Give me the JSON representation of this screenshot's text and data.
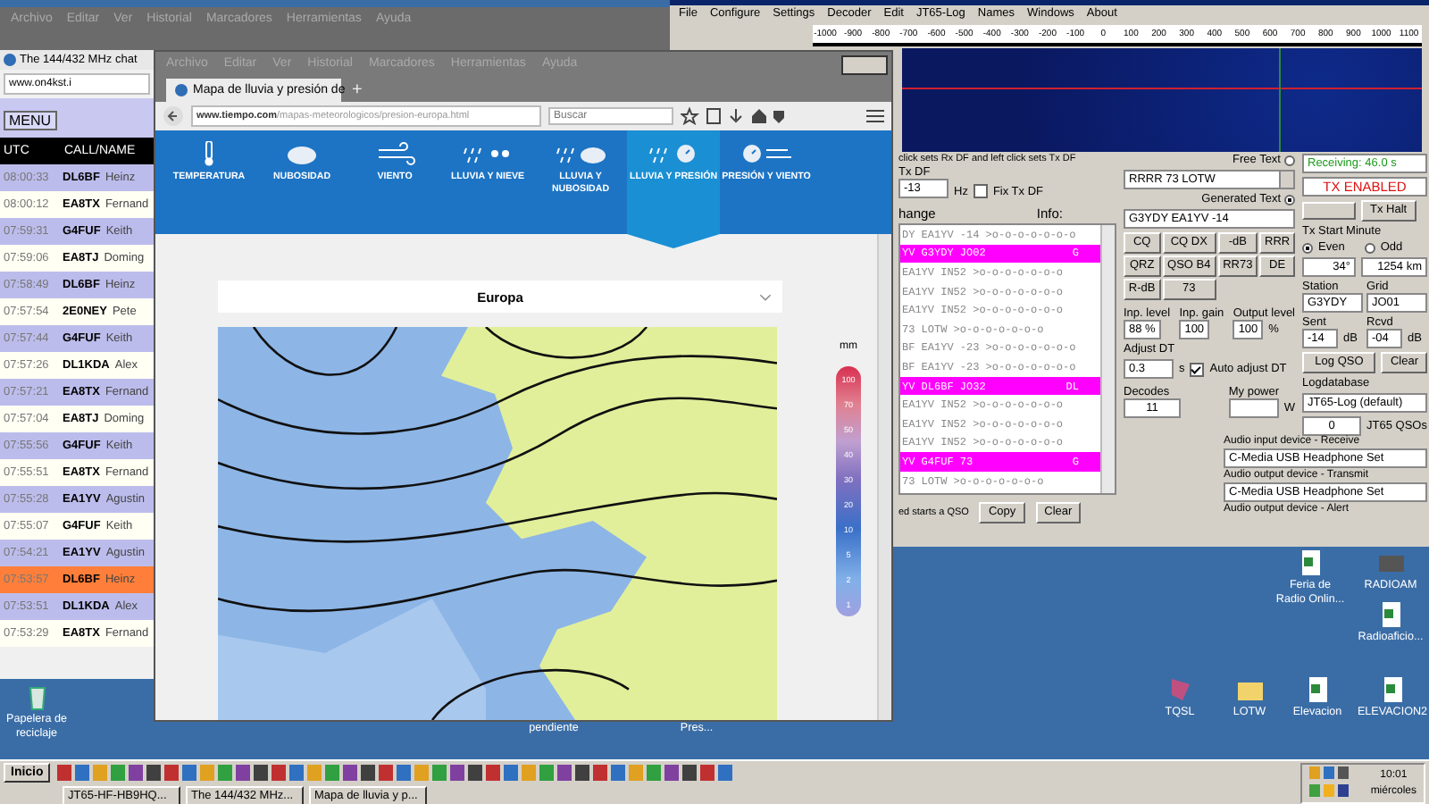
{
  "chat_window": {
    "menu": [
      "Archivo",
      "Editar",
      "Ver",
      "Historial",
      "Marcadores",
      "Herramientas",
      "Ayuda"
    ],
    "tab": "The 144/432 MHz chat",
    "url": "www.on4kst.i",
    "menu_button": "MENU",
    "columns": [
      "UTC",
      "CALL/NAME"
    ],
    "rows": [
      {
        "time": "08:00:33",
        "call": "DL6BF",
        "name": "Heinz",
        "kind": "shaded"
      },
      {
        "time": "08:00:12",
        "call": "EA8TX",
        "name": "Fernand",
        "kind": "plain"
      },
      {
        "time": "07:59:31",
        "call": "G4FUF",
        "name": "Keith",
        "kind": "shaded"
      },
      {
        "time": "07:59:06",
        "call": "EA8TJ",
        "name": "Doming",
        "kind": "plain"
      },
      {
        "time": "07:58:49",
        "call": "DL6BF",
        "name": "Heinz",
        "kind": "shaded"
      },
      {
        "time": "07:57:54",
        "call": "2E0NEY",
        "name": "Pete",
        "kind": "plain"
      },
      {
        "time": "07:57:44",
        "call": "G4FUF",
        "name": "Keith",
        "kind": "shaded"
      },
      {
        "time": "07:57:26",
        "call": "DL1KDA",
        "name": "Alex",
        "kind": "plain"
      },
      {
        "time": "07:57:21",
        "call": "EA8TX",
        "name": "Fernand",
        "kind": "shaded"
      },
      {
        "time": "07:57:04",
        "call": "EA8TJ",
        "name": "Doming",
        "kind": "plain"
      },
      {
        "time": "07:55:56",
        "call": "G4FUF",
        "name": "Keith",
        "kind": "shaded"
      },
      {
        "time": "07:55:51",
        "call": "EA8TX",
        "name": "Fernand",
        "kind": "plain"
      },
      {
        "time": "07:55:28",
        "call": "EA1YV",
        "name": "Agustin",
        "kind": "shaded"
      },
      {
        "time": "07:55:07",
        "call": "G4FUF",
        "name": "Keith",
        "kind": "plain"
      },
      {
        "time": "07:54:21",
        "call": "EA1YV",
        "name": "Agustin",
        "kind": "shaded"
      },
      {
        "time": "07:53:57",
        "call": "DL6BF",
        "name": "Heinz",
        "kind": "highlight"
      },
      {
        "time": "07:53:51",
        "call": "DL1KDA",
        "name": "Alex",
        "kind": "shaded"
      },
      {
        "time": "07:53:29",
        "call": "EA8TX",
        "name": "Fernand",
        "kind": "plain"
      }
    ]
  },
  "browser": {
    "menu": [
      "Archivo",
      "Editar",
      "Ver",
      "Historial",
      "Marcadores",
      "Herramientas",
      "Ayuda"
    ],
    "tab": "Mapa de lluvia y presión de",
    "new_tab": "+",
    "url_domain": "www.tiempo.com",
    "url_path": "/mapas-meteorologicos/presion-europa.html",
    "search": {
      "placeholder": "Buscar"
    },
    "nav": [
      {
        "label": "TEMPERATURA",
        "selected": false
      },
      {
        "label": "NUBOSIDAD",
        "selected": false
      },
      {
        "label": "VIENTO",
        "selected": false
      },
      {
        "label": "LLUVIA Y NIEVE",
        "selected": false
      },
      {
        "label": "LLUVIA Y NUBOSIDAD",
        "selected": false
      },
      {
        "label": "LLUVIA Y PRESIÓN",
        "selected": true
      },
      {
        "label": "PRESIÓN Y VIENTO",
        "selected": false
      }
    ],
    "region_select": "Europa",
    "legend": {
      "unit": "mm",
      "labels": [
        "100",
        "70",
        "50",
        "40",
        "30",
        "20",
        "10",
        "5",
        "2",
        "1"
      ]
    }
  },
  "jt65": {
    "menu": [
      "File",
      "Configure",
      "Settings",
      "Decoder",
      "Edit",
      "JT65-Log",
      "Names",
      "Windows",
      "About"
    ],
    "scale": [
      "-1000",
      "-900",
      "-800",
      "-700",
      "-600",
      "-500",
      "-400",
      "-300",
      "-200",
      "-100",
      "0",
      "100",
      "200",
      "300",
      "400",
      "500",
      "600",
      "700",
      "800",
      "900",
      "1000",
      "1100"
    ],
    "hint": "click sets Rx DF and left click sets Tx DF",
    "tx_df": {
      "label": "Tx DF",
      "value": "-13",
      "unit": "Hz"
    },
    "fix_tx_df": {
      "label": "Fix Tx DF",
      "checked": false
    },
    "list_header": [
      "hange",
      "Info:"
    ],
    "decodes": [
      {
        "text": "DY EA1YV -14 >o-o-o-o-o-o-o",
        "selected": false
      },
      {
        "text": "YV G3YDY JO02",
        "info": "G",
        "selected": true
      },
      {
        "text": "EA1YV IN52 >o-o-o-o-o-o-o",
        "selected": false
      },
      {
        "text": "EA1YV IN52 >o-o-o-o-o-o-o",
        "selected": false
      },
      {
        "text": "EA1YV IN52 >o-o-o-o-o-o-o",
        "selected": false
      },
      {
        "text": "73 LOTW >o-o-o-o-o-o-o",
        "selected": false
      },
      {
        "text": "BF EA1YV -23 >o-o-o-o-o-o-o",
        "selected": false
      },
      {
        "text": "BF EA1YV -23 >o-o-o-o-o-o-o",
        "selected": false
      },
      {
        "text": "YV DL6BF JO32",
        "info": "DL",
        "selected": true
      },
      {
        "text": "EA1YV IN52 >o-o-o-o-o-o-o",
        "selected": false
      },
      {
        "text": "EA1YV IN52 >o-o-o-o-o-o-o",
        "selected": false
      },
      {
        "text": "EA1YV IN52 >o-o-o-o-o-o-o",
        "selected": false
      },
      {
        "text": "YV G4FUF 73",
        "info": "G",
        "selected": true
      },
      {
        "text": "73 LOTW >o-o-o-o-o-o-o",
        "selected": false
      }
    ],
    "list_footer": "ed starts a QSO",
    "copy": "Copy",
    "clear": "Clear",
    "free_text": {
      "label": "Free Text",
      "selected": false
    },
    "free_text_value": "RRRR 73 LOTW",
    "generated_text": {
      "label": "Generated Text",
      "selected": true
    },
    "generated_value": "G3YDY EA1YV -14",
    "macros": [
      "CQ",
      "CQ DX",
      "-dB",
      "RRR",
      "QRZ",
      "QSO B4",
      "RR73",
      "DE",
      "R-dB",
      "73"
    ],
    "levels": [
      {
        "label": "Inp. level",
        "value": "88 %"
      },
      {
        "label": "Inp. gain",
        "value": "100"
      },
      {
        "label": "Output level",
        "value": "100"
      }
    ],
    "level_unit": "%",
    "adjust_dt": {
      "label": "Adjust DT",
      "value": "0.3",
      "unit": "s"
    },
    "auto_dt": {
      "label": "Auto adjust DT",
      "checked": true
    },
    "decodes_count": {
      "label": "Decodes",
      "value": "11"
    },
    "my_power": {
      "label": "My power",
      "unit": "W"
    },
    "audio": [
      {
        "kind": "label",
        "text": "Audio input device - Receive"
      },
      {
        "kind": "value",
        "text": "C-Media USB Headphone Set"
      },
      {
        "kind": "label",
        "text": "Audio output device - Transmit"
      },
      {
        "kind": "value",
        "text": "C-Media USB Headphone Set"
      },
      {
        "kind": "label",
        "text": "Audio output device - Alert"
      }
    ],
    "status": "Receiving: 46.0 s",
    "tx_enabled": "TX ENABLED",
    "tx_halt": "Tx Halt",
    "tx_start": {
      "label": "Tx Start Minute",
      "options": [
        {
          "label": "Even",
          "selected": true
        },
        {
          "label": "Odd",
          "selected": false
        }
      ]
    },
    "bearing": "34°",
    "distance": "1254 km",
    "station": {
      "label": "Station",
      "value": "G3YDY"
    },
    "grid": {
      "label": "Grid",
      "value": "JO01"
    },
    "sent": {
      "label": "Sent",
      "value": "-14",
      "unit": "dB"
    },
    "rcvd": {
      "label": "Rcvd",
      "value": "-04",
      "unit": "dB"
    },
    "log_qso": "Log QSO",
    "log_clear": "Clear",
    "logdb": {
      "label": "Logdatabase",
      "value": "JT65-Log (default)"
    },
    "qso_count": "0",
    "qso_label": "JT65 QSOs"
  },
  "desktop_icons": [
    {
      "label": "Papelera de reciclaje"
    },
    {
      "label": "Feria de Radio Onlin..."
    },
    {
      "label": "RADIOAM"
    },
    {
      "label": "Radioaficio..."
    },
    {
      "label": "TQSL"
    },
    {
      "label": "LOTW"
    },
    {
      "label": "Elevacion"
    },
    {
      "label": "ELEVACION2"
    }
  ],
  "covered_icon_labels": [
    "pendiente",
    "Pres..."
  ],
  "taskbar": {
    "start": "Inicio",
    "tasks": [
      "JT65-HF-HB9HQ...",
      "The 144/432 MHz...",
      "Mapa de lluvia y p..."
    ],
    "clock": "10:01",
    "day": "miércoles"
  }
}
